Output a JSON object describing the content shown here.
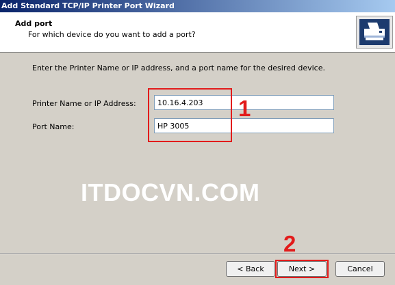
{
  "window": {
    "title": "Add Standard TCP/IP Printer Port Wizard"
  },
  "header": {
    "title": "Add port",
    "subtitle": "For which device do you want to add a port?",
    "icon": "printer-icon"
  },
  "main": {
    "instruction": "Enter the Printer Name or IP address, and a port name for the desired device.",
    "printer_name_label": "Printer Name or IP Address:",
    "printer_name_value": "10.16.4.203",
    "port_name_label": "Port Name:",
    "port_name_value": "HP 3005"
  },
  "annotations": {
    "step1": "1",
    "step2": "2",
    "watermark": "ITDOCVN.COM",
    "highlight_color": "#e21b1b"
  },
  "buttons": {
    "back": "< Back",
    "next": "Next >",
    "cancel": "Cancel"
  }
}
